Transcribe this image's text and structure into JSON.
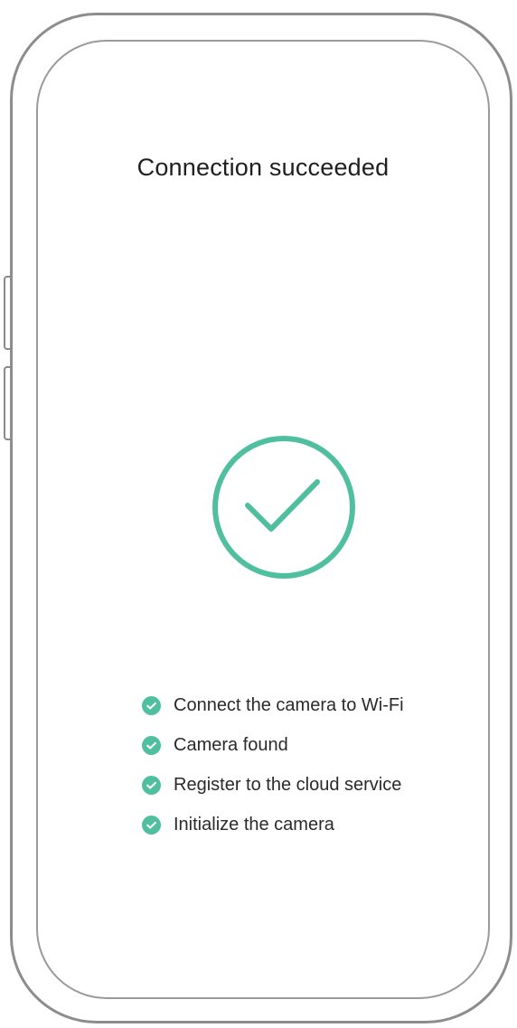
{
  "screen": {
    "title": "Connection succeeded"
  },
  "status_icon": "check-circle",
  "accent_color": "#4fbf9f",
  "steps": [
    {
      "label": "Connect the camera to Wi-Fi",
      "icon": "check-circle",
      "done": true
    },
    {
      "label": "Camera found",
      "icon": "check-circle",
      "done": true
    },
    {
      "label": "Register to the cloud service",
      "icon": "check-circle",
      "done": true
    },
    {
      "label": "Initialize the camera",
      "icon": "check-circle",
      "done": true
    }
  ]
}
